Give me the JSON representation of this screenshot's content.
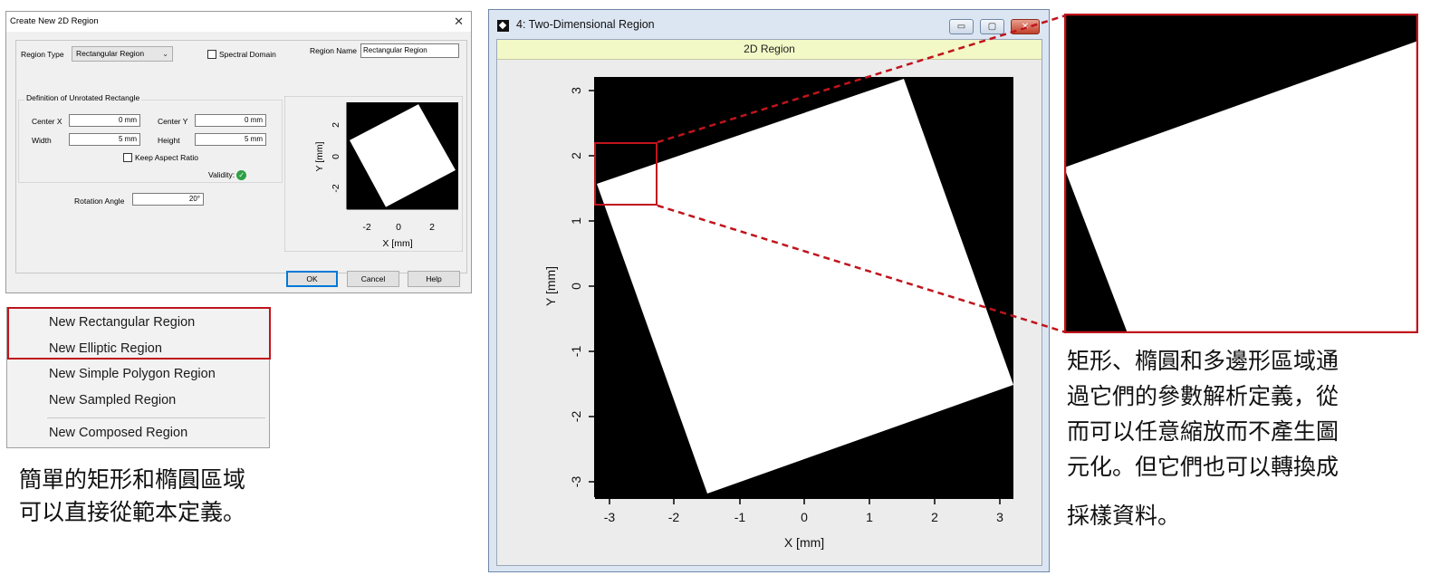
{
  "dialog": {
    "title": "Create New 2D Region",
    "close_glyph": "✕",
    "region_type_label": "Region Type",
    "region_type_value": "Rectangular Region",
    "spectral_domain_label": "Spectral Domain",
    "region_name_label": "Region Name",
    "region_name_value": "Rectangular Region",
    "group_title": "Definition of Unrotated Rectangle",
    "center_x_label": "Center X",
    "center_x_value": "0 mm",
    "center_y_label": "Center Y",
    "center_y_value": "0 mm",
    "width_label": "Width",
    "width_value": "5 mm",
    "height_label": "Height",
    "height_value": "5 mm",
    "keep_aspect_label": "Keep Aspect Ratio",
    "validity_label": "Validity:",
    "rotation_label": "Rotation Angle",
    "rotation_value": "20°",
    "ok": "OK",
    "cancel": "Cancel",
    "help": "Help",
    "preview": {
      "xlabel": "X [mm]",
      "ylabel": "Y [mm]",
      "xticks": [
        "-2",
        "0",
        "2"
      ],
      "yticks": [
        "2",
        "0",
        "-2"
      ]
    }
  },
  "menu": {
    "items": [
      "New Rectangular Region",
      "New Elliptic Region",
      "New Simple Polygon Region",
      "New Sampled Region",
      "New Composed Region"
    ]
  },
  "captions": {
    "left_line1": "簡單的矩形和橢圓區域",
    "left_line2": "可以直接從範本定義。",
    "right_line1": "矩形、橢圓和多邊形區域通",
    "right_line2": "過它們的參數解析定義，從",
    "right_line3": "而可以任意縮放而不產生圖",
    "right_line4": "元化。但它們也可以轉換成",
    "right_line5": "採樣資料。"
  },
  "window": {
    "title": "4: Two-Dimensional Region",
    "header": "2D Region",
    "minimize_glyph": "▭",
    "maximize_glyph": "▢",
    "close_glyph": "✕",
    "plot": {
      "xlabel": "X [mm]",
      "ylabel": "Y [mm]",
      "xticks": [
        "-3",
        "-2",
        "-1",
        "0",
        "1",
        "2",
        "3"
      ],
      "yticks": [
        "3",
        "2",
        "1",
        "0",
        "-1",
        "-2",
        "-3"
      ]
    }
  },
  "colors": {
    "highlight": "#c0141c",
    "plot_background": "#000000",
    "region_fill": "#ffffff",
    "header_band": "#f2f8c6",
    "validity_ok": "#2ea043"
  }
}
